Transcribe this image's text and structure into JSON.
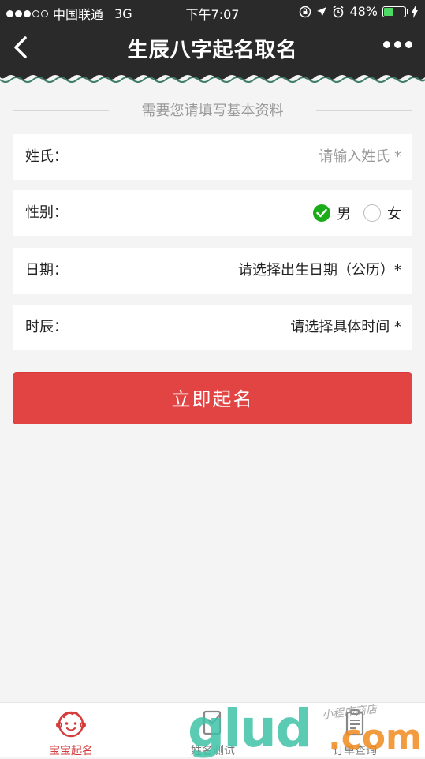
{
  "status_bar": {
    "carrier": "中国联通",
    "network": "3G",
    "time": "下午7:07",
    "battery": "48%",
    "battery_level": 0.48
  },
  "nav": {
    "title": "生辰八字起名取名"
  },
  "form": {
    "section_title": "需要您请填写基本资料",
    "surname": {
      "label": "姓氏：",
      "placeholder": "请输入姓氏 *"
    },
    "gender": {
      "label": "性别：",
      "options": [
        "男",
        "女"
      ],
      "selected": "男"
    },
    "date": {
      "label": "日期：",
      "value": "请选择出生日期（公历）*"
    },
    "hour": {
      "label": "时辰：",
      "value": "请选择具体时间 *"
    }
  },
  "submit_label": "立即起名",
  "tabs": [
    {
      "label": "宝宝起名",
      "active": true
    },
    {
      "label": "姓名测试",
      "active": false
    },
    {
      "label": "订单查询",
      "active": false
    }
  ],
  "watermark": {
    "brand": "glud",
    "domain": ".com",
    "tag": "小程序商店"
  },
  "colors": {
    "accent": "#e24444",
    "check": "#1aad19",
    "header": "#2a2a2a"
  }
}
